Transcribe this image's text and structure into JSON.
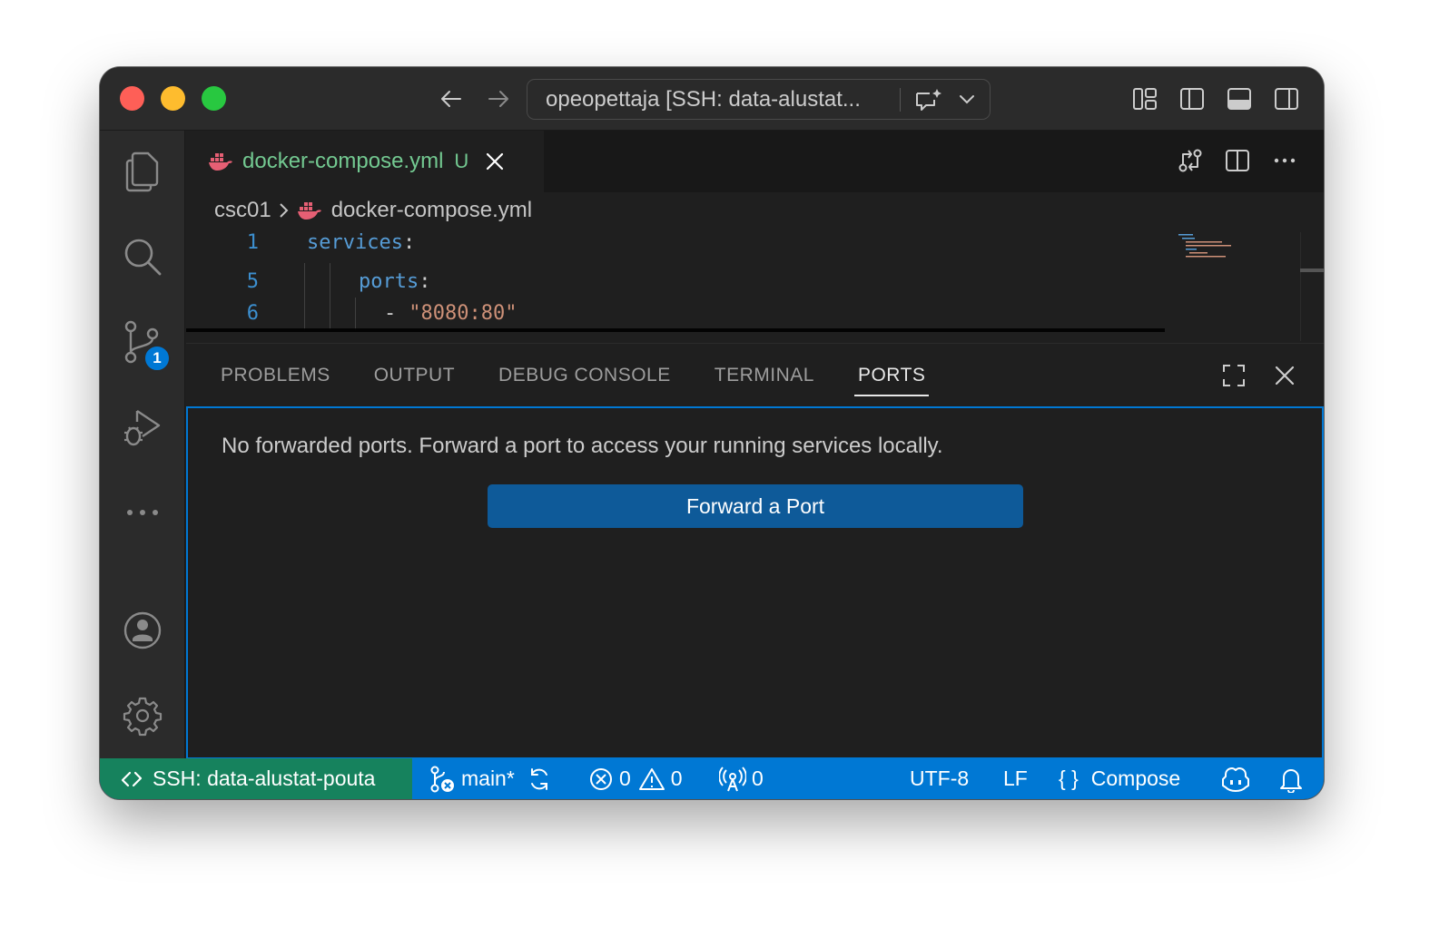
{
  "titlebar": {
    "command_center_title": "opeopettaja [SSH: data-alustat..."
  },
  "activity_bar": {
    "source_control_badge": "1"
  },
  "editor": {
    "tab": {
      "filename": "docker-compose.yml",
      "git_status": "U"
    },
    "breadcrumb": {
      "folder": "csc01",
      "file": "docker-compose.yml"
    },
    "lines": [
      {
        "number": "1",
        "key": "services",
        "colon": ":"
      },
      {
        "number": "5",
        "key": "ports",
        "colon": ":"
      },
      {
        "number": "6",
        "dash": "-",
        "value": "\"8080:80\""
      }
    ]
  },
  "panel": {
    "tabs": [
      {
        "label": "PROBLEMS"
      },
      {
        "label": "OUTPUT"
      },
      {
        "label": "DEBUG CONSOLE"
      },
      {
        "label": "TERMINAL"
      },
      {
        "label": "PORTS"
      }
    ],
    "active_tab": "PORTS",
    "ports": {
      "message": "No forwarded ports. Forward a port to access your running services locally.",
      "button_label": "Forward a Port"
    }
  },
  "statusbar": {
    "remote": "SSH: data-alustat-pouta",
    "branch": "main*",
    "errors": "0",
    "warnings": "0",
    "forwarded_ports": "0",
    "encoding": "UTF-8",
    "eol": "LF",
    "language_braces": "{ }",
    "language": "Compose"
  },
  "colors": {
    "status_bar": "#0078d4",
    "remote_indicator": "#16825d",
    "button": "#0e5a99",
    "untracked_file": "#73c991"
  }
}
